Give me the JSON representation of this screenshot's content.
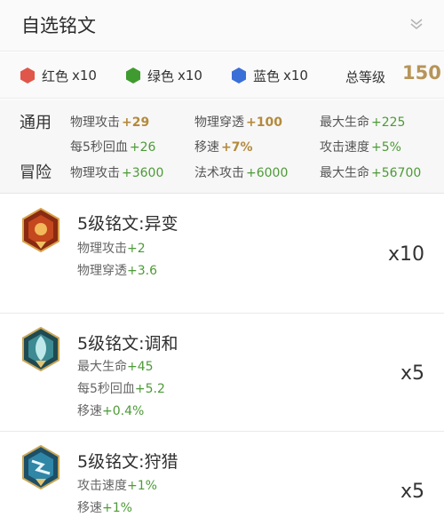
{
  "header": {
    "title": "自选铭文",
    "toggle_icon": "chevron-double-down-icon"
  },
  "summary": {
    "chips": [
      {
        "icon": "red-hexagon-icon",
        "color": "#e0564a",
        "label": "红色",
        "count": "x10"
      },
      {
        "icon": "green-hexagon-icon",
        "color": "#3f9b2f",
        "label": "绿色",
        "count": "x10"
      },
      {
        "icon": "blue-hexagon-icon",
        "color": "#3b6fd8",
        "label": "蓝色",
        "count": "x10"
      }
    ],
    "level_label": "总等级",
    "level_value": "150"
  },
  "stats": {
    "general_label": "通用",
    "adventure_label": "冒险",
    "general": [
      [
        {
          "name": "物理攻击",
          "value": "+29",
          "highlight": true
        },
        {
          "name": "物理穿透",
          "value": "+100",
          "highlight": true
        },
        {
          "name": "最大生命",
          "value": "+225",
          "highlight": false
        }
      ],
      [
        {
          "name": "每5秒回血",
          "value": "+26",
          "highlight": false
        },
        {
          "name": "移速",
          "value": "+7%",
          "highlight": true
        },
        {
          "name": "攻击速度",
          "value": "+5%",
          "highlight": false
        }
      ]
    ],
    "adventure": [
      {
        "name": "物理攻击",
        "value": "+3600"
      },
      {
        "name": "法术攻击",
        "value": "+6000"
      },
      {
        "name": "最大生命",
        "value": "+56700"
      }
    ]
  },
  "runes": [
    {
      "icon": "rune-mutation-icon",
      "name": "5级铭文:异变",
      "qty": "x10",
      "lines": [
        {
          "name": "物理攻击",
          "value": "+2"
        },
        {
          "name": "物理穿透",
          "value": "+3.6"
        }
      ]
    },
    {
      "icon": "rune-harmony-icon",
      "name": "5级铭文:调和",
      "qty": "x5",
      "lines": [
        {
          "name": "最大生命",
          "value": "+45"
        },
        {
          "name": "每5秒回血",
          "value": "+5.2"
        },
        {
          "name": "移速",
          "value": "+0.4%"
        }
      ]
    },
    {
      "icon": "rune-hunt-icon",
      "name": "5级铭文:狩猎",
      "qty": "x5",
      "lines": [
        {
          "name": "攻击速度",
          "value": "+1%"
        },
        {
          "name": "移速",
          "value": "+1%"
        }
      ]
    }
  ]
}
